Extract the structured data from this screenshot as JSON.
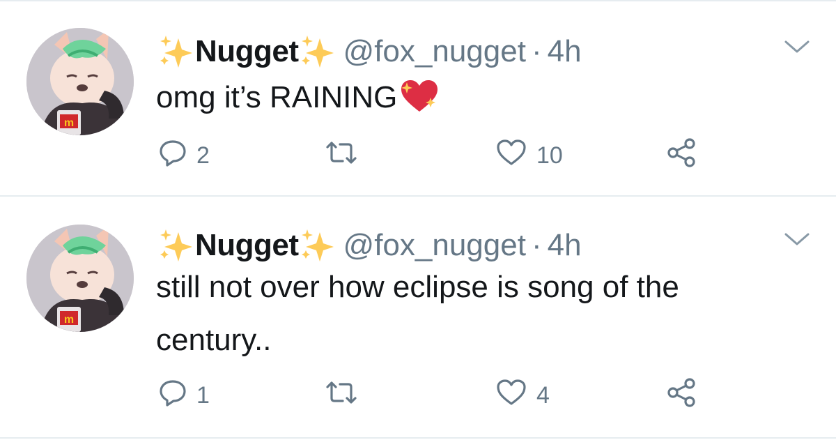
{
  "tweets": [
    {
      "display_name": "Nugget",
      "handle": "@fox_nugget",
      "separator": "·",
      "time": "4h",
      "text": "omg it’s RAINING",
      "trailing_emoji": "sparkling-heart-emoji",
      "replies": "2",
      "retweets": "",
      "likes": "10"
    },
    {
      "display_name": "Nugget",
      "handle": "@fox_nugget",
      "separator": "·",
      "time": "4h",
      "text": "still not over how eclipse is song of the century..",
      "replies": "1",
      "retweets": "",
      "likes": "4"
    }
  ],
  "icons": {
    "name_decoration": "sparkles-emoji",
    "menu": "chevron-down-icon",
    "reply": "reply-icon",
    "retweet": "retweet-icon",
    "like": "heart-icon",
    "share": "share-icon"
  },
  "colors": {
    "text": "#14171a",
    "secondary": "#657786",
    "divider": "#e6ecf0",
    "sparkle": "#fdcb58",
    "heart_emoji": "#dd2e44"
  }
}
